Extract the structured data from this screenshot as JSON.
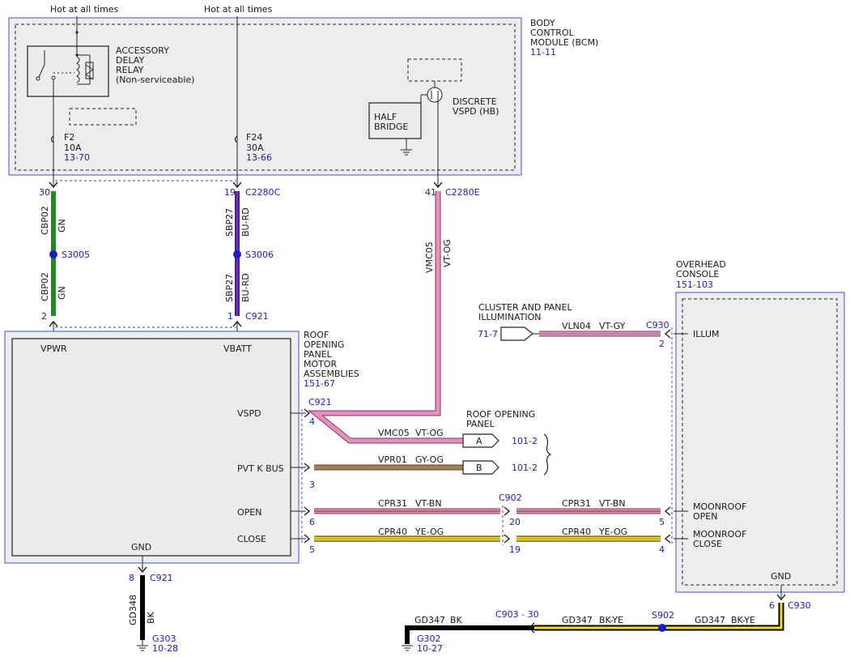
{
  "power": {
    "hot1": "Hot at all times",
    "hot2": "Hot at all times"
  },
  "bcm": {
    "title": [
      "BODY",
      "CONTROL",
      "MODULE (BCM)"
    ],
    "ref": "11-11",
    "relay": [
      "ACCESSORY",
      "DELAY",
      "RELAY",
      "(Non-serviceable)"
    ],
    "half_bridge": [
      "HALF",
      "BRIDGE"
    ],
    "discrete": [
      "DISCRETE",
      "VSPD (HB)"
    ],
    "fuse_f2": {
      "name": "F2",
      "amps": "10A",
      "ref": "13-70"
    },
    "fuse_f24": {
      "name": "F24",
      "amps": "30A",
      "ref": "13-66"
    }
  },
  "connectors": {
    "c2280c": "C2280C",
    "c2280e": "C2280E",
    "c921": "C921",
    "c902": "C902",
    "c930": "C930",
    "c903": "C903 -  30",
    "pin_30": "30",
    "pin_19": "19",
    "pin_41": "41",
    "pin_2": "2",
    "pin_1": "1",
    "pin_4": "4",
    "pin_3": "3",
    "pin_6": "6",
    "pin_5": "5",
    "pin_8": "8",
    "pin_20": "20",
    "pin_19b": "19",
    "pin_5b": "5",
    "pin_4b": "4",
    "pin_2b": "2",
    "pin_6b": "6"
  },
  "splices": {
    "s3005": "S3005",
    "s3006": "S3006",
    "s902": "S902"
  },
  "wires": {
    "cbp02": "CBP02",
    "gn": "GN",
    "sbp27": "SBP27",
    "burd": "BU-RD",
    "vmc05": "VMC05",
    "vtog": "VT-OG",
    "vln04": "VLN04",
    "vtgy": "VT-GY",
    "vpr01": "VPR01",
    "gyog": "GY-OG",
    "cpr31": "CPR31",
    "vtbn": "VT-BN",
    "cpr40": "CPR40",
    "yeog": "YE-OG",
    "gd348": "GD348",
    "bk": "BK",
    "gd347": "GD347",
    "bkye": "BK-YE"
  },
  "colors": {
    "green": "#1f8a1f",
    "blue_red": "#3a1fb0",
    "violet_orange": "#e88fc0",
    "brown": "#a08058",
    "yellow": "#f2e316",
    "black": "#000000",
    "label_blue": "#1c1cc8",
    "module_border": "#4b4bd8"
  },
  "ropma": {
    "title": [
      "ROOF",
      "OPENING",
      "PANEL",
      "MOTOR",
      "ASSEMBLIES"
    ],
    "ref": "151-67",
    "pins": {
      "vpwr": "VPWR",
      "vbatt": "VBATT",
      "vspd": "VSPD",
      "pvtk": "PVT K BUS",
      "open": "OPEN",
      "close": "CLOSE",
      "gnd": "GND"
    }
  },
  "overhead": {
    "title": [
      "OVERHEAD",
      "CONSOLE"
    ],
    "ref": "151-103",
    "pins": {
      "illum": "ILLUM",
      "mopen": [
        "MOONROOF",
        "OPEN"
      ],
      "mclose": [
        "MOONROOF",
        "CLOSE"
      ],
      "gnd": "GND"
    }
  },
  "cluster": {
    "title": [
      "CLUSTER AND PANEL",
      "ILLUMINATION"
    ],
    "ref": "71-7"
  },
  "roof_panel": {
    "title": [
      "ROOF OPENING",
      "PANEL"
    ],
    "a": "A",
    "b": "B",
    "ref_a": "101-2",
    "ref_b": "101-2"
  },
  "grounds": {
    "g303": "G303",
    "g303_ref": "10-28",
    "g302": "G302",
    "g302_ref": "10-27"
  }
}
